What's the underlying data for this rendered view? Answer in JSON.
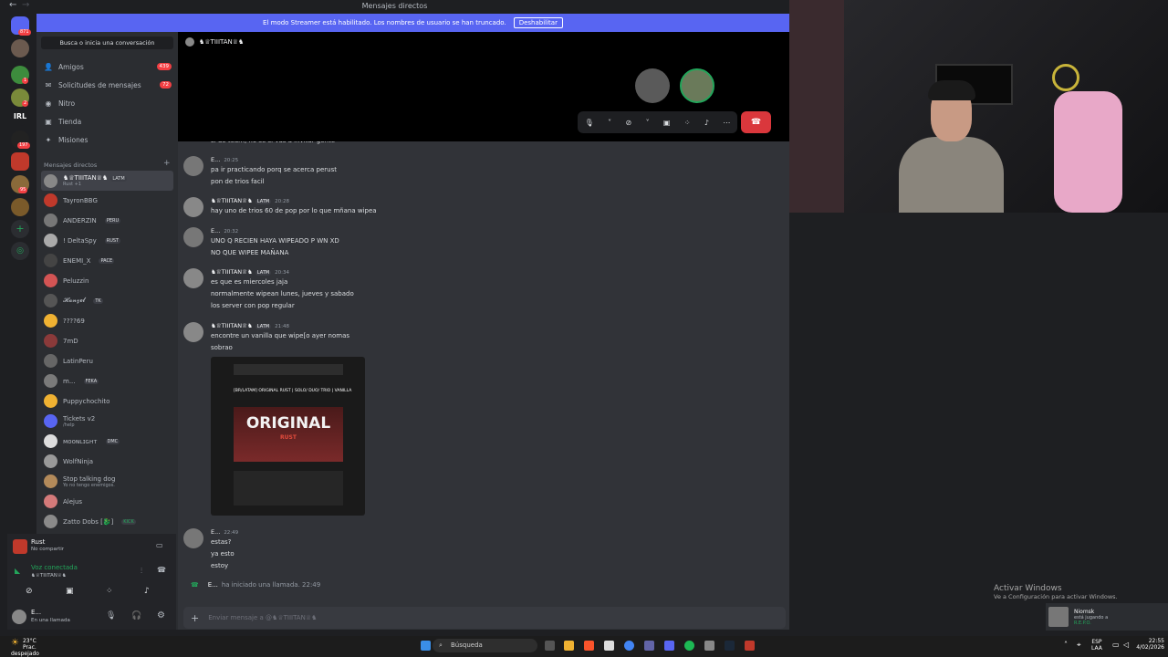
{
  "titlebar": {
    "title": "Mensajes directos",
    "back": "←",
    "forward": "→"
  },
  "banner": {
    "text": "El modo Streamer está habilitado. Los nombres de usuario se han truncado.",
    "button": "Deshabilitar"
  },
  "servers": {
    "badges": [
      "871",
      "1",
      "2",
      "197",
      "95"
    ],
    "labels": [
      "IRL"
    ]
  },
  "sidebar": {
    "search_placeholder": "Busca o inicia una conversación",
    "nav": [
      {
        "label": "Amigos",
        "count": "439",
        "icon": "friends-icon"
      },
      {
        "label": "Solicitudes de mensajes",
        "count": "72",
        "icon": "mail-icon"
      },
      {
        "label": "Nitro",
        "count": "",
        "icon": "nitro-icon"
      },
      {
        "label": "Tienda",
        "count": "",
        "icon": "shop-icon"
      },
      {
        "label": "Misiones",
        "count": "",
        "icon": "quests-icon"
      }
    ],
    "dm_header": "Mensajes directos",
    "dms": [
      {
        "name": "♞♕TIIITAN♕♞",
        "tag": "LATM",
        "sub": "Rust +1"
      },
      {
        "name": "TayronBBG",
        "tag": "",
        "sub": ""
      },
      {
        "name": "ANDERZIN",
        "tag": "PERU",
        "sub": ""
      },
      {
        "name": "! DeltaSpy",
        "tag": "RUST",
        "sub": ""
      },
      {
        "name": "ENEMI_X",
        "tag": "PACE",
        "sub": ""
      },
      {
        "name": "Peluzzin",
        "tag": "",
        "sub": ""
      },
      {
        "name": "𝓗𝓪𝓷𝔃𝓮𝓵",
        "tag": "TK",
        "sub": ""
      },
      {
        "name": "????69",
        "tag": "",
        "sub": ""
      },
      {
        "name": "7mD",
        "tag": "",
        "sub": ""
      },
      {
        "name": "LatinPeru",
        "tag": "",
        "sub": ""
      },
      {
        "name": "m...",
        "tag": "FEKA",
        "sub": ""
      },
      {
        "name": "Puppychochito",
        "tag": "",
        "sub": ""
      },
      {
        "name": "Tickets v2",
        "tag": "",
        "sub": "/help"
      },
      {
        "name": "ᴍᴏᴏɴʟɪɢʜᴛ",
        "tag": "DMC",
        "sub": ""
      },
      {
        "name": "WolfNinja",
        "tag": "",
        "sub": ""
      },
      {
        "name": "Stop talking dog",
        "tag": "",
        "sub": "Yo no tengo enemigos."
      },
      {
        "name": "Alejus",
        "tag": "",
        "sub": ""
      },
      {
        "name": "Zatto Dobs [🐉]",
        "tag": "KICK",
        "sub": ""
      }
    ]
  },
  "activity": {
    "game": "Rust",
    "game_sub": "No compartir",
    "voice": "Voz conectada",
    "voice_sub": "♞♕TIIITAN♕♞"
  },
  "user": {
    "name": "E...",
    "status": "En una llamada"
  },
  "call": {
    "name": "♞♕TIIITAN♕♞"
  },
  "messages": [
    {
      "author": "",
      "time": "",
      "tag": "",
      "lines": [
        "si de team, no se si vas a invitar gente"
      ]
    },
    {
      "author": "E...",
      "time": "20:25",
      "tag": "",
      "lines": [
        "pa ir practicando porq se acerca perust",
        "pon de trios facil"
      ]
    },
    {
      "author": "♞♕TIIITAN♕♞",
      "time": "20:28",
      "tag": "LATM",
      "lines": [
        "hay uno de trios 60 de pop por lo que mñana wipea"
      ]
    },
    {
      "author": "E...",
      "time": "20:32",
      "tag": "",
      "lines": [
        "UNO Q RECIEN HAYA WIPEADO P WN XD",
        "NO QUE WIPEE MAÑANA"
      ]
    },
    {
      "author": "♞♕TIIITAN♕♞",
      "time": "20:34",
      "tag": "LATM",
      "lines": [
        "es que es miercoles jaja",
        "normalmente wipean lunes, jueves y sabado",
        "los server con pop regular"
      ]
    },
    {
      "author": "♞♕TIIITAN♕♞",
      "time": "21:48",
      "tag": "LATM",
      "lines": [
        "encontre un vanilla que wipe[o ayer nomas",
        "sobrao"
      ]
    },
    {
      "author": "E...",
      "time": "22:49",
      "tag": "",
      "lines": [
        "estas?",
        "ya esto",
        "estoy"
      ]
    }
  ],
  "embed": {
    "header": "[BR/LATAM] ORIGINAL RUST | SOLO/ DUO/ TRIO | VANILLA",
    "title": "ORIGINAL",
    "subtitle": "RUST"
  },
  "call_event": {
    "name": "E...",
    "text": "ha iniciado una llamada.",
    "time": "22:49"
  },
  "composer": {
    "placeholder": "Enviar mensaje a @♞♕TIIITAN♕♞"
  },
  "windows": {
    "activate_title": "Activar Windows",
    "activate_sub": "Ve a Configuración para activar Windows."
  },
  "toast": {
    "name": "Niomsk",
    "line": "está jugando a",
    "game": "R.E.P.O."
  },
  "taskbar": {
    "weather_temp": "23°C",
    "weather_desc": "Prac. despejado",
    "search": "Búsqueda",
    "lang1": "ESP",
    "lang2": "LAA",
    "time": "22:55",
    "date": "4/02/2026"
  },
  "colors": {
    "accent": "#5865f2",
    "danger": "#da373c",
    "online": "#23a55a"
  }
}
